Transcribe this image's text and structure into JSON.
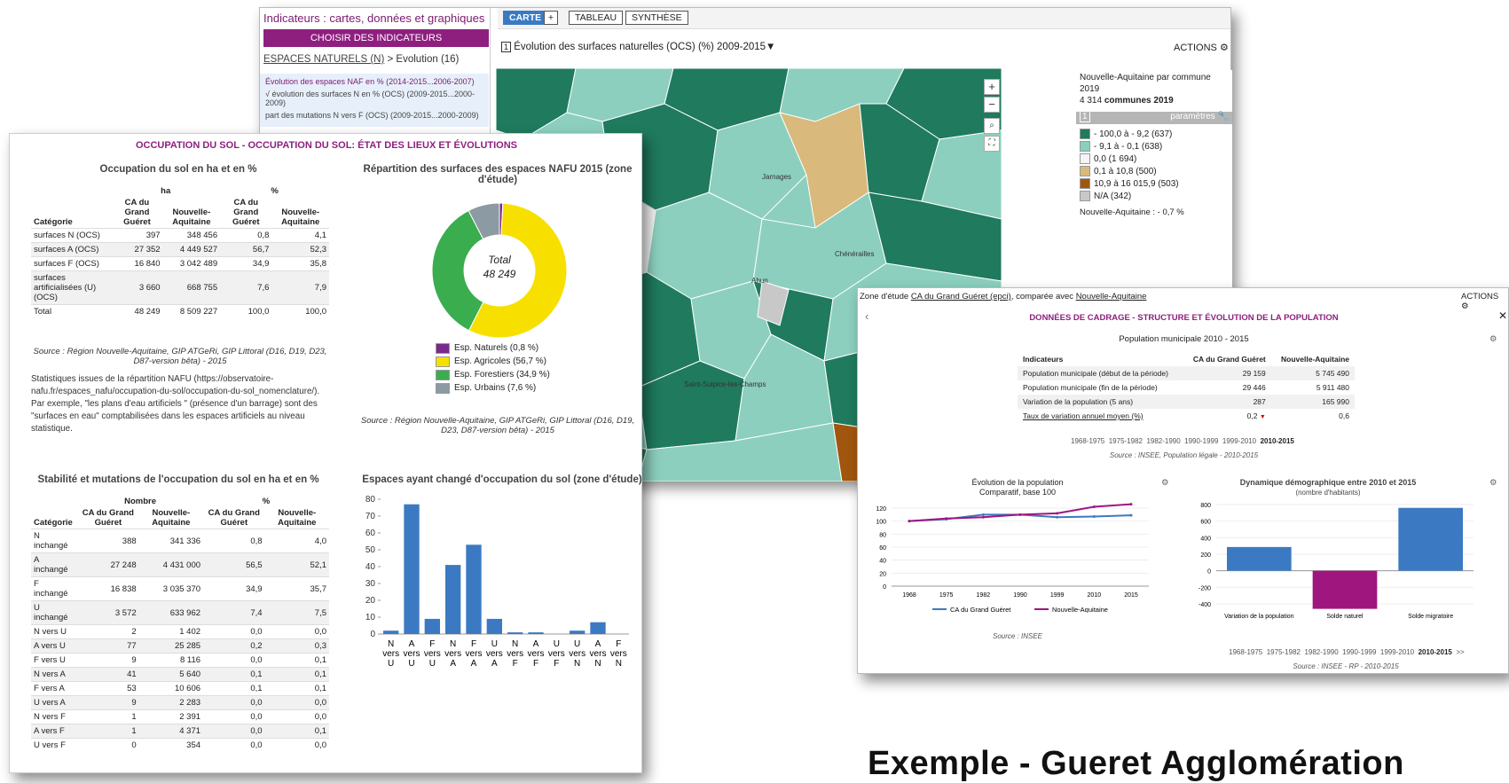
{
  "back": {
    "title": "Indicateurs : cartes, données et graphiques",
    "choose_btn": "CHOISIR DES INDICATEURS",
    "bc_link": "ESPACES NATURELS (N)",
    "bc_rest": " > Evolution (16)",
    "list": [
      "Évolution des espaces NAF en % (2014-2015...2006-2007)",
      "√ évolution des surfaces N en % (OCS) (2009-2015...2000-2009)",
      "part des mutations N vers F (OCS) (2009-2015...2000-2009)"
    ],
    "tabs": {
      "carte": "CARTE",
      "plus": "+",
      "tableau": "TABLEAU",
      "synthese": "SYNTHÈSE"
    },
    "map_title_num": "1",
    "map_title": "Évolution des surfaces naturelles (OCS) (%)  2009-2015▼",
    "actions": "ACTIONS",
    "places": [
      "Jarnages",
      "Chénérailles",
      "Ahun",
      "Saint-Sulpice-les-Champs"
    ],
    "legend": {
      "l1": "Nouvelle-Aquitaine par commune",
      "l2": "2019",
      "l3a": "4 314 ",
      "l3b": "communes 2019",
      "num": "1",
      "params": "paramètres",
      "items": [
        {
          "color": "#1f7a5e",
          "label": "- 100,0 à - 9,2 (637)"
        },
        {
          "color": "#8ccfbe",
          "label": "- 9,1 à - 0,1 (638)"
        },
        {
          "color": "#f4f4f4",
          "label": "0,0 (1 694)"
        },
        {
          "color": "#d9b97c",
          "label": "0,1 à 10,8 (500)"
        },
        {
          "color": "#a0560f",
          "label": "10,9 à 16 015,9 (503)"
        },
        {
          "color": "#c8c8c8",
          "label": "N/A (342)"
        }
      ],
      "footer": "Nouvelle-Aquitaine : - 0,7 %"
    }
  },
  "left": {
    "title": "OCCUPATION DU SOL - OCCUPATION DU SOL: ÉTAT DES LIEUX ET ÉVOLUTIONS",
    "t1_title": "Occupation du sol en ha et en %",
    "t1_units": [
      "ha",
      "%"
    ],
    "t1_cols": [
      "Catégorie",
      "CA du Grand Guéret",
      "Nouvelle-Aquitaine",
      "CA du Grand Guéret",
      "Nouvelle-Aquitaine"
    ],
    "t1_rows": [
      [
        "surfaces N (OCS)",
        "397",
        "348 456",
        "0,8",
        "4,1"
      ],
      [
        "surfaces A (OCS)",
        "27 352",
        "4 449 527",
        "56,7",
        "52,3"
      ],
      [
        "surfaces F (OCS)",
        "16 840",
        "3 042 489",
        "34,9",
        "35,8"
      ],
      [
        "surfaces artificialisées (U) (OCS)",
        "3 660",
        "668 755",
        "7,6",
        "7,9"
      ],
      [
        "Total",
        "48 249",
        "8 509 227",
        "100,0",
        "100,0"
      ]
    ],
    "t1_source": "Source : Région Nouvelle-Aquitaine, GIP ATGeRi, GIP Littoral (D16, D19, D23, D87-version bêta) - 2015",
    "t1_note": "Statistiques issues de la répartition NAFU (https://observatoire-nafu.fr/espaces_nafu/occupation-du-sol/occupation-du-sol_nomenclature/). Par exemple, \"les plans d'eau artificiels \" (présence d'un barrage) sont des \"surfaces en eau\" comptabilisées dans les espaces artificiels au niveau statistique.",
    "pie_title": "Répartition des surfaces des espaces NAFU 2015 (zone d'étude)",
    "pie_center1": "Total",
    "pie_center2": "48 249",
    "pie_source": "Source : Région Nouvelle-Aquitaine, GIP ATGeRi, GIP Littoral (D16, D19, D23, D87-version bêta) - 2015",
    "t2_title": "Stabilité et mutations de l'occupation du sol en ha et en %",
    "t2_units": [
      "Nombre",
      "%"
    ],
    "t2_cols": [
      "Catégorie",
      "CA du Grand Guéret",
      "Nouvelle-Aquitaine",
      "CA du Grand Guéret",
      "Nouvelle-Aquitaine"
    ],
    "t2_rows": [
      [
        "N inchangé",
        "388",
        "341 336",
        "0,8",
        "4,0"
      ],
      [
        "A inchangé",
        "27 248",
        "4 431 000",
        "56,5",
        "52,1"
      ],
      [
        "F inchangé",
        "16 838",
        "3 035 370",
        "34,9",
        "35,7"
      ],
      [
        "U inchangé",
        "3 572",
        "633 962",
        "7,4",
        "7,5"
      ],
      [
        "N vers U",
        "2",
        "1 402",
        "0,0",
        "0,0"
      ],
      [
        "A vers U",
        "77",
        "25 285",
        "0,2",
        "0,3"
      ],
      [
        "F vers U",
        "9",
        "8 116",
        "0,0",
        "0,1"
      ],
      [
        "N vers A",
        "41",
        "5 640",
        "0,1",
        "0,1"
      ],
      [
        "F vers A",
        "53",
        "10 606",
        "0,1",
        "0,1"
      ],
      [
        "U vers A",
        "9",
        "2 283",
        "0,0",
        "0,0"
      ],
      [
        "N vers F",
        "1",
        "2 391",
        "0,0",
        "0,0"
      ],
      [
        "A vers F",
        "1",
        "4 371",
        "0,0",
        "0,1"
      ],
      [
        "U vers F",
        "0",
        "354",
        "0,0",
        "0,0"
      ]
    ],
    "bar_title": "Espaces ayant changé d'occupation du sol (zone d'étude)"
  },
  "right": {
    "zone_pre": "Zone d'étude ",
    "zone_link1": "CA du Grand Guéret (epci)",
    "zone_mid": ", comparée avec ",
    "zone_link2": "Nouvelle-Aquitaine",
    "actions": "ACTIONS",
    "section": "DONNÉES DE CADRAGE - STRUCTURE ET ÉVOLUTION DE LA POPULATION",
    "pop_title": "Population municipale 2010 - 2015",
    "cols": [
      "Indicateurs",
      "CA du Grand Guéret",
      "Nouvelle-Aquitaine"
    ],
    "rows": [
      [
        "Population municipale (début de la période)",
        "29 159",
        "5 745 490"
      ],
      [
        "Population municipale (fin de la période)",
        "29 446",
        "5 911 480"
      ],
      [
        "Variation de la population (5 ans)",
        "287",
        "165 990"
      ],
      [
        "Taux de variation annuel moyen (%)",
        "0,2",
        "0,6"
      ]
    ],
    "periods": [
      "1968-1975",
      "1975-1982",
      "1982-1990",
      "1990-1999",
      "1999-2010",
      "2010-2015"
    ],
    "source1": "Source : INSEE, Population légale - 2010-2015",
    "line_title1": "Évolution de la population",
    "line_title2": "Comparatif, base 100",
    "line_source": "Source : INSEE",
    "bar_title1": "Dynamique démographique entre 2010 et 2015",
    "bar_title2": "(nombre d'habitants)",
    "periods2": [
      "1968-1975",
      "1975-1982",
      "1982-1990",
      "1990-1999",
      "1999-2010",
      "2010-2015",
      ">>"
    ],
    "source2": "Source : INSEE - RP - 2010-2015"
  },
  "big_title": "Exemple - Gueret Agglomération",
  "chart_data": [
    {
      "type": "pie",
      "title": "Répartition des surfaces des espaces NAFU 2015 (zone d'étude)",
      "series": [
        {
          "values": [
            0.8,
            56.7,
            34.9,
            7.6
          ]
        }
      ],
      "categories": [
        "Esp. Naturels (0,8 %)",
        "Esp. Agricoles (56,7 %)",
        "Esp. Forestiers (34,9 %)",
        "Esp. Urbains (7,6 %)"
      ],
      "colors": [
        "#7b2a8c",
        "#f7e000",
        "#3aad4f",
        "#8c9aa3"
      ]
    },
    {
      "type": "bar",
      "title": "Espaces ayant changé d'occupation du sol (zone d'étude)",
      "categories": [
        "N vers U",
        "A vers U",
        "F vers U",
        "N vers A",
        "F vers A",
        "U vers A",
        "N vers F",
        "A vers F",
        "U vers F",
        "U vers N",
        "A vers N",
        "F vers N"
      ],
      "tick_top": [
        "N",
        "A",
        "F",
        "N",
        "F",
        "U",
        "N",
        "A",
        "U",
        "U",
        "A",
        "F"
      ],
      "tick_mid": [
        "vers",
        "vers",
        "vers",
        "vers",
        "vers",
        "vers",
        "vers",
        "vers",
        "vers",
        "vers",
        "vers",
        "vers"
      ],
      "tick_bot": [
        "U",
        "U",
        "U",
        "A",
        "A",
        "A",
        "F",
        "F",
        "F",
        "N",
        "N",
        "N"
      ],
      "values": [
        2,
        77,
        9,
        41,
        53,
        9,
        1,
        1,
        0,
        2,
        7,
        0
      ],
      "ylim": [
        0,
        80
      ],
      "yticks": [
        0,
        10,
        20,
        30,
        40,
        50,
        60,
        70,
        80
      ],
      "color": "#3b7ac2"
    },
    {
      "type": "line",
      "title": "Évolution de la population Comparatif, base 100",
      "x": [
        "1968",
        "1975",
        "1982",
        "1990",
        "1999",
        "2010",
        "2015"
      ],
      "series": [
        {
          "name": "CA du Grand Guéret",
          "color": "#3b7ac2",
          "values": [
            100,
            103,
            110,
            110,
            106,
            107,
            109
          ]
        },
        {
          "name": "Nouvelle-Aquitaine",
          "color": "#a0167f",
          "values": [
            100,
            104,
            106,
            110,
            112,
            122,
            126
          ]
        }
      ],
      "ylim": [
        0,
        120
      ],
      "yticks": [
        0,
        20,
        40,
        60,
        80,
        100,
        120
      ]
    },
    {
      "type": "bar",
      "title": "Dynamique démographique entre 2010 et 2015",
      "categories": [
        "Variation de la population",
        "Solde naturel",
        "Solde migratoire"
      ],
      "values": [
        287,
        -460,
        760
      ],
      "colors": [
        "#3b7ac2",
        "#a0167f",
        "#3b7ac2"
      ],
      "ylim": [
        -400,
        800
      ],
      "yticks": [
        -400,
        -200,
        0,
        200,
        400,
        600,
        800
      ]
    }
  ]
}
